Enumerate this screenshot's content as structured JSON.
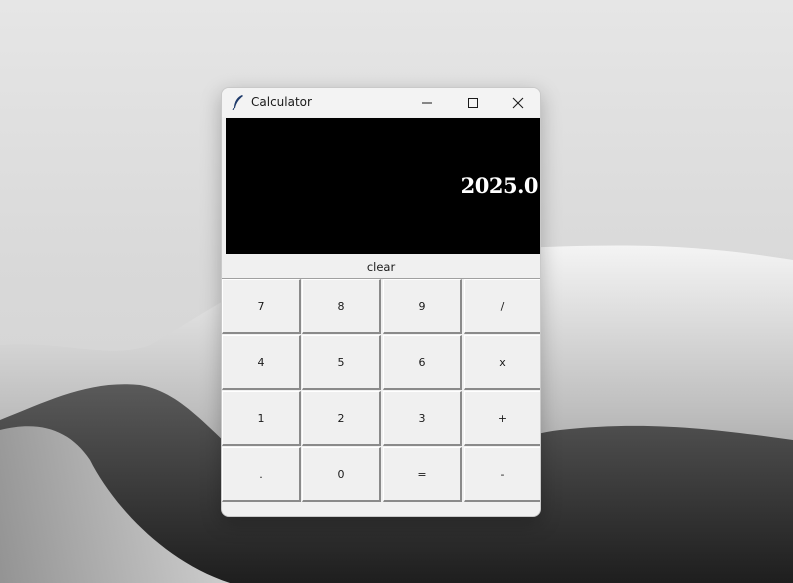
{
  "window": {
    "title": "Calculator",
    "icon": "feather-icon"
  },
  "display": {
    "value": "2025.0"
  },
  "clear_label": "clear",
  "keys": [
    [
      "7",
      "8",
      "9",
      "/"
    ],
    [
      "4",
      "5",
      "6",
      "x"
    ],
    [
      "1",
      "2",
      "3",
      "+"
    ],
    [
      ".",
      "0",
      "=",
      "-"
    ]
  ],
  "colors": {
    "display_bg": "#000000",
    "display_text": "#ffffff",
    "window_bg": "#f0f0f0"
  }
}
